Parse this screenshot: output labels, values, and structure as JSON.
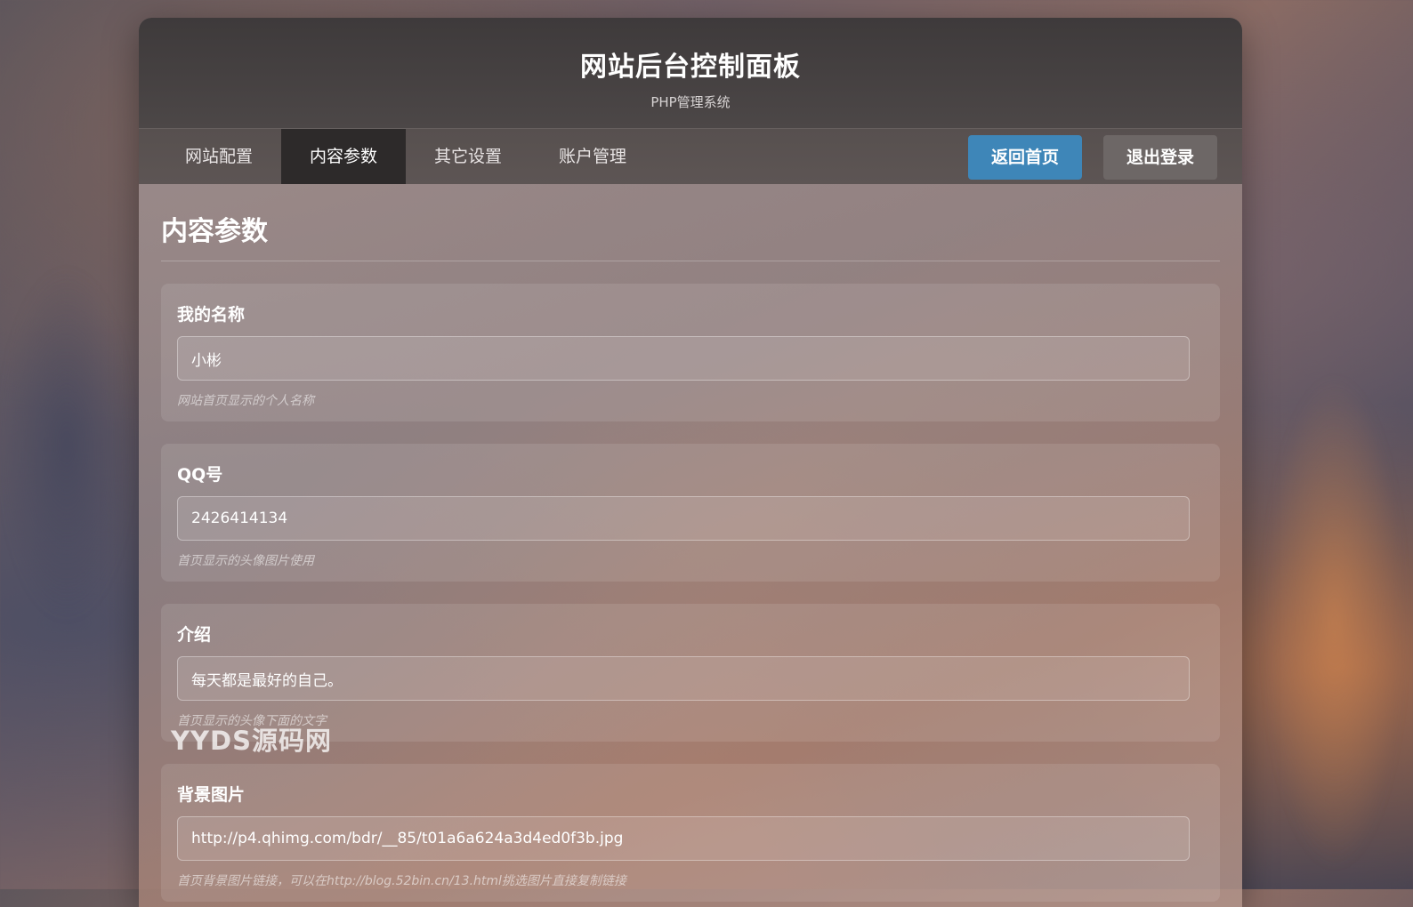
{
  "header": {
    "title": "网站后台控制面板",
    "subtitle": "PHP管理系统"
  },
  "nav": {
    "tabs": [
      {
        "label": "网站配置",
        "active": false
      },
      {
        "label": "内容参数",
        "active": true
      },
      {
        "label": "其它设置",
        "active": false
      },
      {
        "label": "账户管理",
        "active": false
      }
    ],
    "home_button": "返回首页",
    "logout_button": "退出登录"
  },
  "main": {
    "section_title": "内容参数",
    "fields": [
      {
        "label": "我的名称",
        "value": "小彬",
        "hint": "网站首页显示的个人名称"
      },
      {
        "label": "QQ号",
        "value": "2426414134",
        "hint": "首页显示的头像图片使用"
      },
      {
        "label": "介绍",
        "value": "每天都是最好的自己。",
        "hint": "首页显示的头像下面的文字"
      },
      {
        "label": "背景图片",
        "value": "http://p4.qhimg.com/bdr/__85/t01a6a624a3d4ed0f3b.jpg",
        "hint": "首页背景图片链接，可以在http://blog.52bin.cn/13.html挑选图片直接复制链接"
      }
    ]
  },
  "watermark": "YYDS源码网",
  "colors": {
    "header_bg": "#3e3a3b",
    "active_tab_bg": "#2d2a2a",
    "home_button_bg": "#3e86b8",
    "logout_button_bg": "#6d6766"
  }
}
